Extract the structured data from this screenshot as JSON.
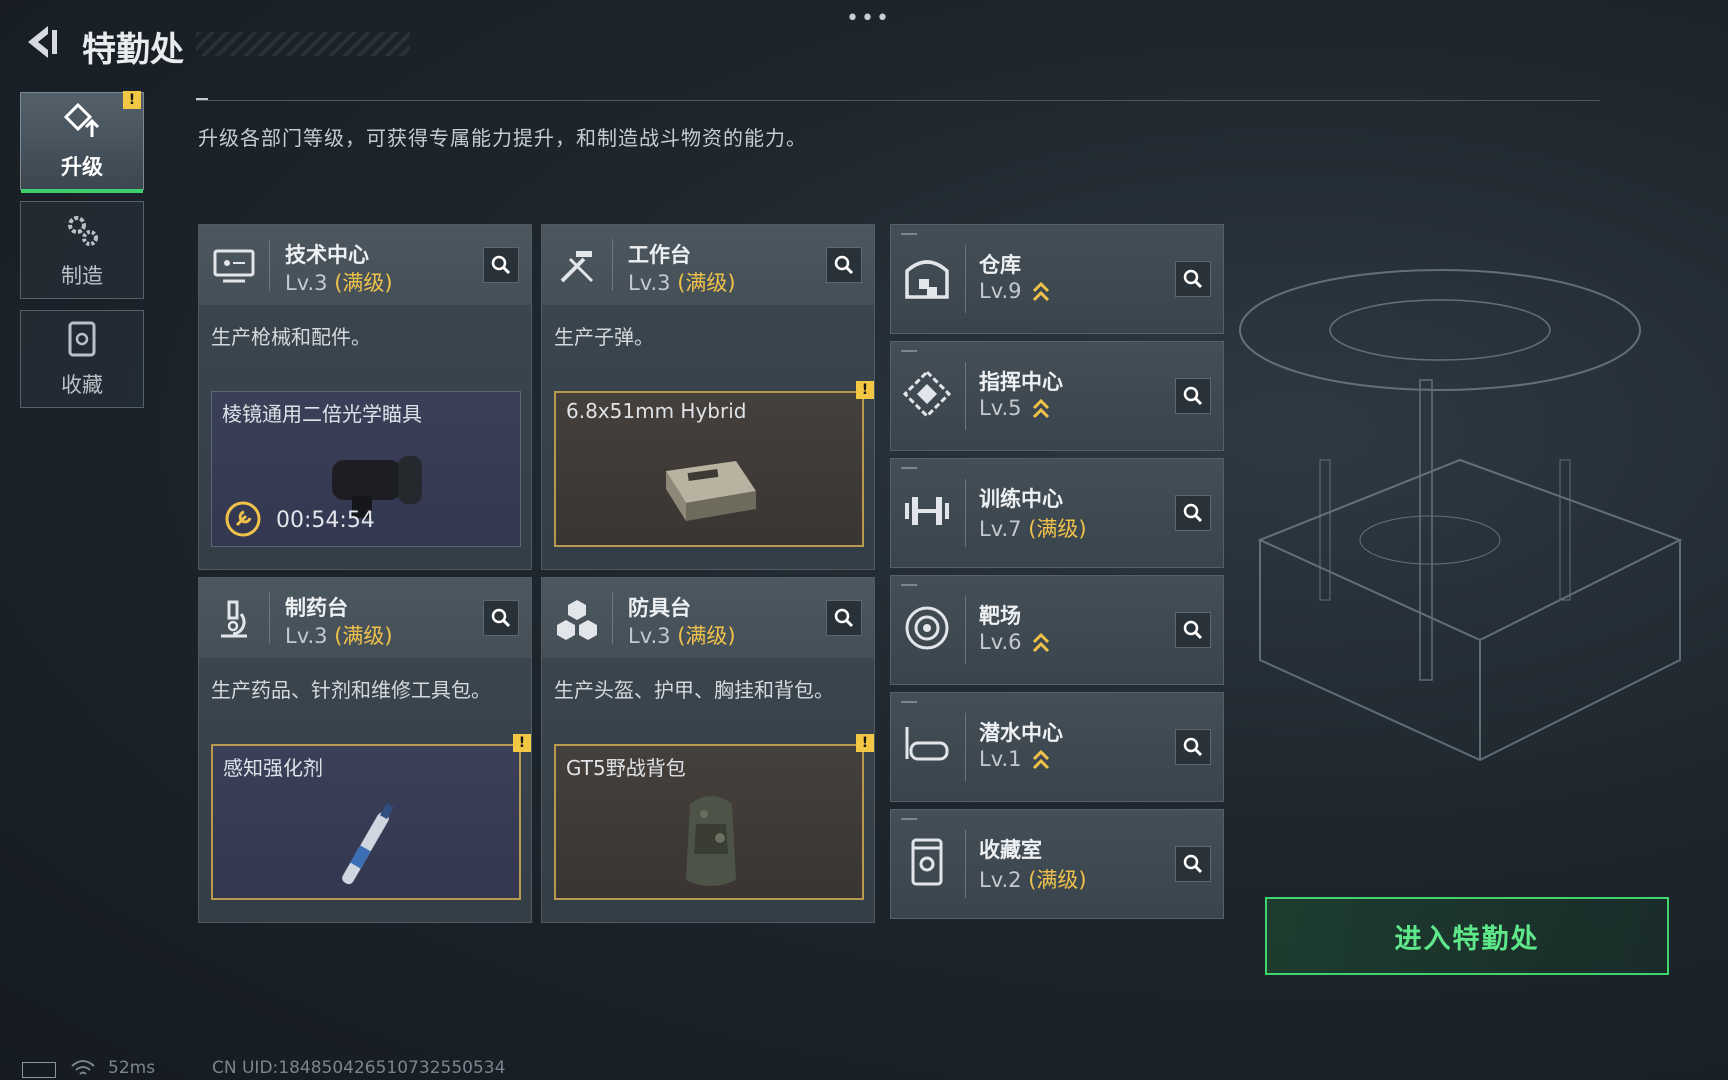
{
  "header": {
    "title": "特勤处",
    "menu_dots": "•••"
  },
  "description": "升级各部门等级，可获得专属能力提升，和制造战斗物资的能力。",
  "side_nav": [
    {
      "label": "升级",
      "icon": "upgrade-icon",
      "active": true,
      "warning": "!"
    },
    {
      "label": "制造",
      "icon": "gears-icon",
      "active": false
    },
    {
      "label": "收藏",
      "icon": "collection-icon",
      "active": false
    }
  ],
  "workshops": [
    {
      "name": "技术中心",
      "level": "Lv.3",
      "max": "(满级)",
      "icon": "monitor-icon",
      "desc": "生产枪械和配件。",
      "craft": {
        "name": "棱镜通用二倍光学瞄具",
        "timer": "00:54:54"
      }
    },
    {
      "name": "工作台",
      "level": "Lv.3",
      "max": "(满级)",
      "icon": "tools-icon",
      "desc": "生产子弹。",
      "craft": {
        "name": "6.8x51mm Hybrid",
        "warning": "!"
      }
    },
    {
      "name": "制药台",
      "level": "Lv.3",
      "max": "(满级)",
      "icon": "microscope-icon",
      "desc": "生产药品、针剂和维修工具包。",
      "craft": {
        "name": "感知强化剂",
        "warning": "!"
      }
    },
    {
      "name": "防具台",
      "level": "Lv.3",
      "max": "(满级)",
      "icon": "blocks-icon",
      "desc": "生产头盔、护甲、胸挂和背包。",
      "craft": {
        "name": "GT5野战背包",
        "warning": "!"
      }
    }
  ],
  "facilities": [
    {
      "name": "仓库",
      "level": "Lv.9",
      "max": "",
      "upgradable": true,
      "icon": "warehouse-icon"
    },
    {
      "name": "指挥中心",
      "level": "Lv.5",
      "max": "",
      "upgradable": true,
      "icon": "command-icon"
    },
    {
      "name": "训练中心",
      "level": "Lv.7",
      "max": "(满级)",
      "upgradable": false,
      "icon": "dumbbell-icon"
    },
    {
      "name": "靶场",
      "level": "Lv.6",
      "max": "",
      "upgradable": true,
      "icon": "target-icon"
    },
    {
      "name": "潜水中心",
      "level": "Lv.1",
      "max": "",
      "upgradable": true,
      "icon": "diving-mask-icon"
    },
    {
      "name": "收藏室",
      "level": "Lv.2",
      "max": "(满级)",
      "upgradable": false,
      "icon": "vault-icon"
    }
  ],
  "enter_button": "进入特勤处",
  "status": {
    "ping": "52ms",
    "uid": "CN UID:184850426510732550534"
  },
  "colors": {
    "accent_green": "#3fd46c",
    "gold": "#f0c24a",
    "warning": "#f2c744"
  }
}
